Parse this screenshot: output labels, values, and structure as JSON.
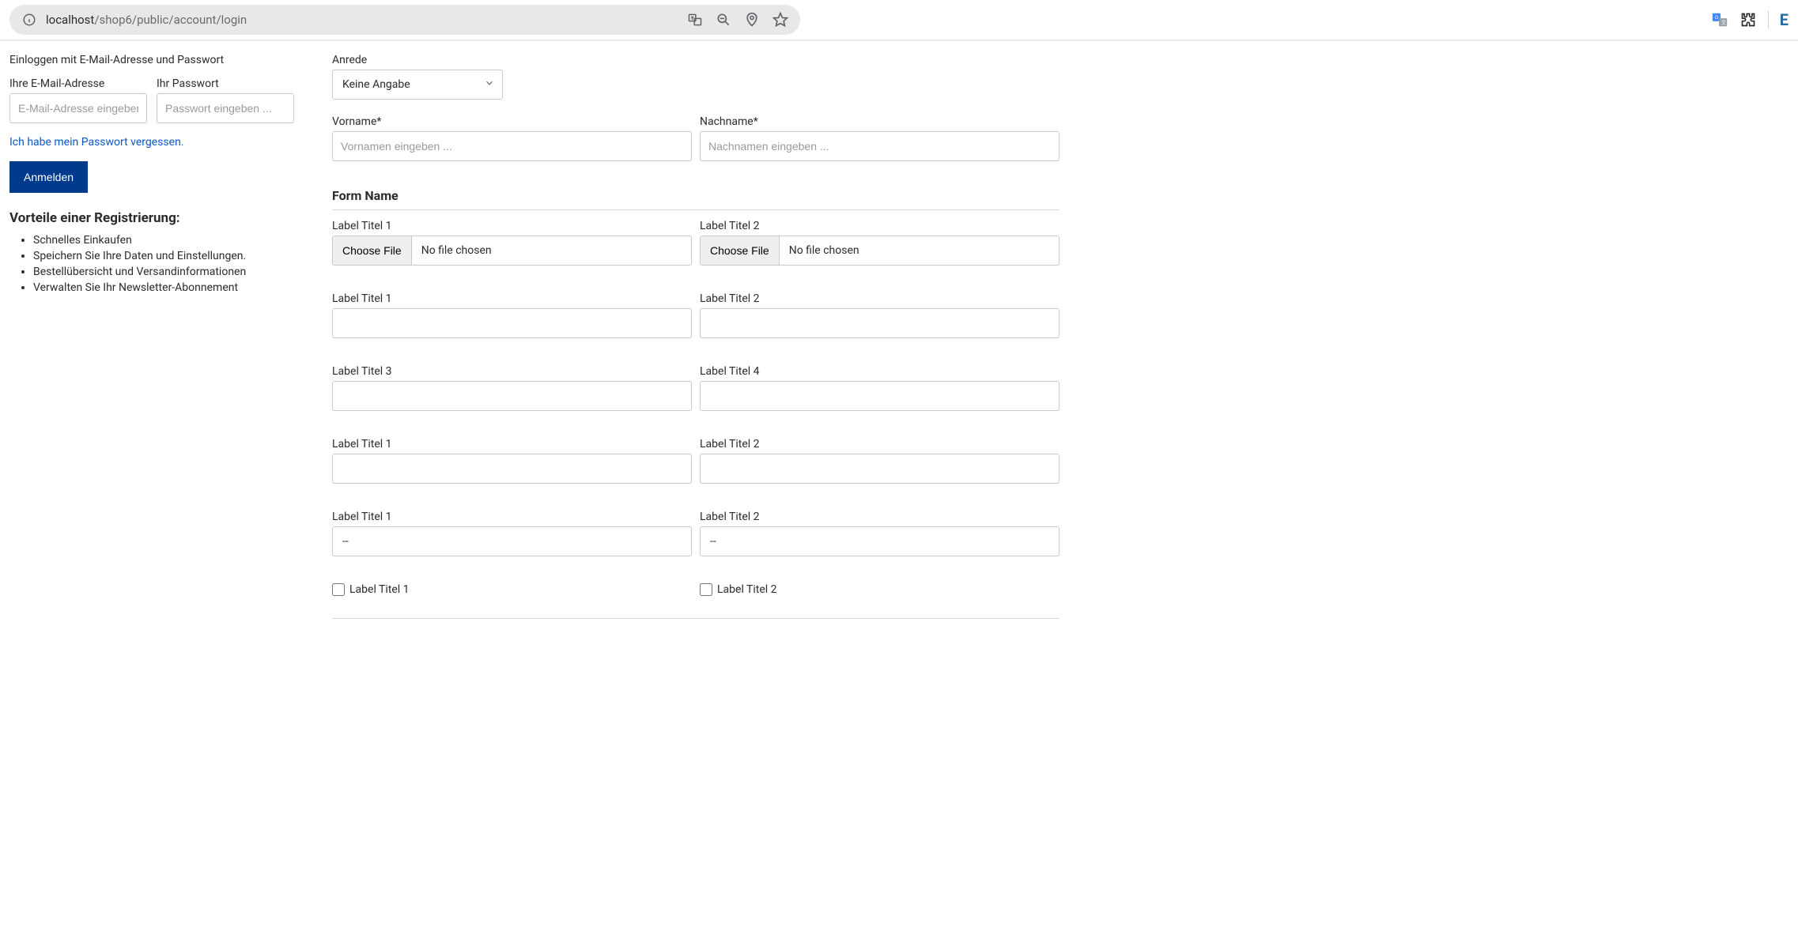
{
  "browser": {
    "url_host": "localhost",
    "url_path": "/shop6/public/account/login"
  },
  "login": {
    "title": "Einloggen mit E-Mail-Adresse und Passwort",
    "email_label": "Ihre E-Mail-Adresse",
    "email_placeholder": "E-Mail-Adresse eingeben ...",
    "password_label": "Ihr Passwort",
    "password_placeholder": "Passwort eingeben ...",
    "forgot_link": "Ich habe mein Passwort vergessen.",
    "submit_label": "Anmelden"
  },
  "advantages": {
    "title": "Vorteile einer Registrierung:",
    "items": [
      "Schnelles Einkaufen",
      "Speichern Sie Ihre Daten und Einstellungen.",
      "Bestellübersicht und Versandinformationen",
      "Verwalten Sie Ihr Newsletter-Abonnement"
    ]
  },
  "register": {
    "salutation_label": "Anrede",
    "salutation_value": "Keine Angabe",
    "firstname_label": "Vorname*",
    "firstname_placeholder": "Vornamen eingeben ...",
    "lastname_label": "Nachname*",
    "lastname_placeholder": "Nachnamen eingeben ..."
  },
  "custom_form": {
    "title": "Form Name",
    "file1_label": "Label Titel 1",
    "file2_label": "Label Titel 2",
    "file_choose": "Choose File",
    "file_none": "No file chosen",
    "text1_label": "Label Titel 1",
    "text2_label": "Label Titel 2",
    "text3_label": "Label Titel 3",
    "text4_label": "Label Titel 4",
    "text5_label": "Label Titel 1",
    "text6_label": "Label Titel 2",
    "select1_label": "Label Titel 1",
    "select2_label": "Label Titel 2",
    "select_value": "--",
    "check1_label": "Label Titel 1",
    "check2_label": "Label Titel 2"
  }
}
